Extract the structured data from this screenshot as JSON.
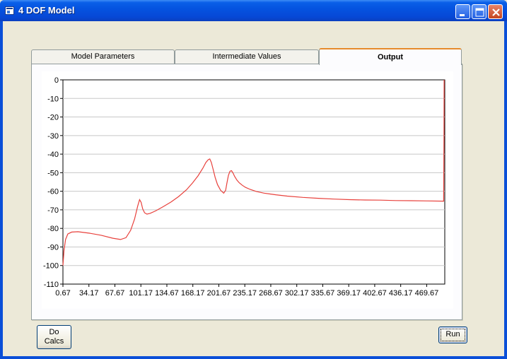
{
  "window": {
    "title": "4 DOF Model"
  },
  "tabs": [
    {
      "label": "Model Parameters",
      "active": false
    },
    {
      "label": "Intermediate Values",
      "active": false
    },
    {
      "label": "Output",
      "active": true
    }
  ],
  "buttons": {
    "do_calcs_line1": "Do",
    "do_calcs_line2": "Calcs",
    "run": "Run"
  },
  "icons": {
    "app": "window-app-icon",
    "minimize": "minimize-icon",
    "maximize": "maximize-icon",
    "close": "close-icon"
  },
  "colors": {
    "series": "#e8413c",
    "grid": "#c8c8c8",
    "titlebar": "#0553e0",
    "tab_highlight": "#e68b2c"
  },
  "chart_data": {
    "type": "line",
    "title": "",
    "xlabel": "",
    "ylabel": "",
    "grid": true,
    "xlim": [
      0.67,
      493
    ],
    "ylim": [
      -110,
      0
    ],
    "x_ticks": [
      0.67,
      34.17,
      67.67,
      101.17,
      134.67,
      168.17,
      201.67,
      235.17,
      268.67,
      302.17,
      335.67,
      369.17,
      402.67,
      436.17,
      469.67
    ],
    "x_tick_labels": [
      "0.67",
      "34.17",
      "67.67",
      "101.17",
      "134.67",
      "168.17",
      "201.67",
      "235.17",
      "268.67",
      "302.17",
      "335.67",
      "369.17",
      "402.67",
      "436.17",
      "469.67"
    ],
    "y_ticks": [
      0,
      -10,
      -20,
      -30,
      -40,
      -50,
      -60,
      -70,
      -80,
      -90,
      -100,
      -110
    ],
    "y_tick_labels": [
      "0",
      "-10",
      "-20",
      "-30",
      "-40",
      "-50",
      "-60",
      "-70",
      "-80",
      "-90",
      "-100",
      "-110"
    ],
    "series": [
      {
        "color": "#e8413c",
        "x": [
          0.67,
          2,
          4,
          7,
          12,
          20,
          35,
          50,
          65,
          75,
          82,
          88,
          93,
          97,
          99.5,
          101.5,
          103.5,
          106,
          109,
          113,
          120,
          130,
          140,
          150,
          160,
          168,
          175,
          181,
          185,
          188,
          190,
          192,
          194.5,
          197,
          200,
          204,
          208,
          210.5,
          212,
          214,
          216,
          218,
          220,
          222,
          225,
          228,
          232,
          236,
          242,
          250,
          260,
          275,
          290,
          310,
          330,
          350,
          370,
          390,
          410,
          430,
          450,
          470,
          490,
          491.5,
          492,
          492.2
        ],
        "y": [
          -100,
          -92,
          -86,
          -83,
          -82,
          -81.8,
          -82.6,
          -83.7,
          -85.3,
          -86,
          -85,
          -81,
          -75,
          -68,
          -64.5,
          -66,
          -69.5,
          -71.6,
          -72.3,
          -71.9,
          -70.6,
          -68.3,
          -65.8,
          -62.8,
          -59.2,
          -55.4,
          -51.6,
          -47.6,
          -44.5,
          -43,
          -42.6,
          -44.5,
          -48.5,
          -52.6,
          -56.4,
          -59.5,
          -61,
          -59.5,
          -55.8,
          -51.5,
          -49.2,
          -48.9,
          -50.2,
          -52,
          -54,
          -55.4,
          -56.8,
          -57.9,
          -59,
          -60.1,
          -61,
          -61.9,
          -62.6,
          -63.3,
          -63.8,
          -64.2,
          -64.5,
          -64.7,
          -64.8,
          -65,
          -65.1,
          -65.2,
          -65.3,
          -65.3,
          -30,
          0
        ]
      }
    ]
  }
}
